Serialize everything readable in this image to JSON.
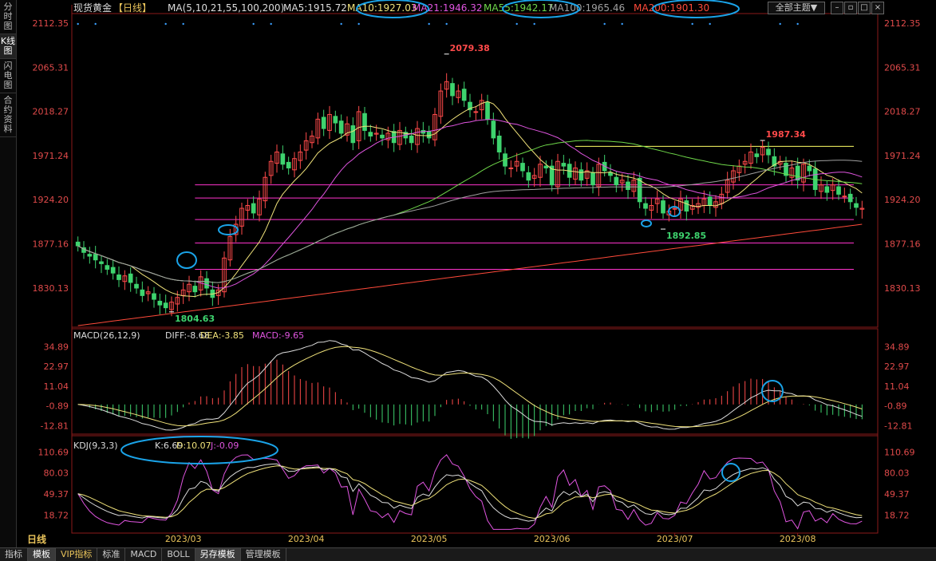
{
  "sidebar": {
    "tabs": [
      {
        "label": "分时图",
        "active": false
      },
      {
        "label": "K线图",
        "active": true
      },
      {
        "label": "闪电图",
        "active": false
      },
      {
        "label": "合约资料",
        "active": false
      }
    ]
  },
  "header": {
    "instrument": "现货黄金",
    "period_tag": "【日线】",
    "ma_label": "MA(5,10,21,55,100,200)",
    "ma_values": [
      {
        "label": "MA5:1915.72",
        "color": "#dcdcdc"
      },
      {
        "label": "MA10:1927.03",
        "color": "#f0e27a"
      },
      {
        "label": "MA21:1946.32",
        "color": "#e055e0"
      },
      {
        "label": "MA55:1942.17",
        "color": "#6fd84a"
      },
      {
        "label": "MA100:1965.46",
        "color": "#a0a0a0"
      },
      {
        "label": "MA200:1901.30",
        "color": "#ff4a3a"
      }
    ],
    "theme_button": "全部主题▼"
  },
  "bottom_tabs": [
    {
      "label": "指标",
      "vip": false,
      "active": false
    },
    {
      "label": "模板",
      "vip": false,
      "active": true
    },
    {
      "label": "VIP指标",
      "vip": true,
      "active": false
    },
    {
      "label": "标准",
      "vip": false,
      "active": false
    },
    {
      "label": "MACD",
      "vip": false,
      "active": false
    },
    {
      "label": "BOLL",
      "vip": false,
      "active": false
    },
    {
      "label": "另存模板",
      "vip": false,
      "active": true
    },
    {
      "label": "管理模板",
      "vip": false,
      "active": false
    }
  ],
  "period_label": "日线",
  "chart_data": [
    {
      "type": "candlestick",
      "x_ticks": [
        "2023/03",
        "2023/04",
        "2023/05",
        "2023/06",
        "2023/07",
        "2023/08"
      ],
      "y_ticks": [
        2112.35,
        2065.31,
        2018.27,
        1971.24,
        1924.2,
        1877.16,
        1830.13
      ],
      "ylim": [
        1790,
        2120
      ],
      "annotations": [
        {
          "text": "2079.38",
          "value": 2079.38
        },
        {
          "text": "1987.34",
          "value": 1987.34
        },
        {
          "text": "1892.85",
          "value": 1892.85
        },
        {
          "text": "1804.63",
          "value": 1804.63
        }
      ],
      "horizontal_levels": [
        {
          "value": 1981,
          "color": "#ffff66"
        },
        {
          "value": 1940,
          "color": "#ff33cc"
        },
        {
          "value": 1926,
          "color": "#ff33cc"
        },
        {
          "value": 1903,
          "color": "#ff33cc"
        },
        {
          "value": 1878,
          "color": "#ff33cc"
        },
        {
          "value": 1850,
          "color": "#ff33cc"
        }
      ],
      "closes": [
        1875,
        1868,
        1864,
        1860,
        1856,
        1850,
        1846,
        1839,
        1843,
        1836,
        1830,
        1822,
        1826,
        1818,
        1812,
        1809,
        1815,
        1820,
        1828,
        1834,
        1826,
        1842,
        1830,
        1820,
        1828,
        1862,
        1885,
        1898,
        1915,
        1918,
        1910,
        1925,
        1948,
        1965,
        1975,
        1962,
        1958,
        1968,
        1975,
        1987,
        1992,
        2010,
        2000,
        2015,
        2006,
        1995,
        2005,
        1985,
        2018,
        1998,
        1992,
        1995,
        1990,
        1995,
        1985,
        1998,
        1990,
        1985,
        2000,
        1995,
        1990,
        2015,
        2040,
        2050,
        2035,
        2040,
        2030,
        2020,
        2018,
        2030,
        2010,
        1990,
        1975,
        1960,
        1958,
        1965,
        1955,
        1945,
        1950,
        1962,
        1958,
        1940,
        1965,
        1960,
        1948,
        1958,
        1945,
        1955,
        1940,
        1962,
        1955,
        1950,
        1940,
        1945,
        1935,
        1945,
        1922,
        1915,
        1918,
        1925,
        1910,
        1912,
        1915,
        1925,
        1912,
        1918,
        1920,
        1925,
        1918,
        1922,
        1930,
        1945,
        1955,
        1960,
        1965,
        1975,
        1970,
        1980,
        1972,
        1960,
        1965,
        1950,
        1958,
        1945,
        1962,
        1955,
        1935,
        1940,
        1932,
        1940,
        1930,
        1928,
        1922,
        1916,
        1915
      ],
      "moving_averages": [
        {
          "name": "MA10",
          "color": "#f0e27a"
        },
        {
          "name": "MA21",
          "color": "#e055e0"
        },
        {
          "name": "MA55",
          "color": "#6fd84a"
        },
        {
          "name": "MA100",
          "color": "#a0a0a0"
        },
        {
          "name": "MA200",
          "color": "#ff4a3a",
          "values_start": 1790,
          "values_end": 1898
        }
      ]
    },
    {
      "type": "macd",
      "title": "MACD(26,12,9)",
      "legend": [
        {
          "label": "DIFF:-8.68",
          "color": "#dcdcdc"
        },
        {
          "label": "DEA:-3.85",
          "color": "#f0e27a"
        },
        {
          "label": "MACD:-9.65",
          "color": "#e055e0"
        }
      ],
      "y_ticks": [
        34.89,
        22.97,
        11.04,
        -0.89,
        -12.81
      ],
      "ylim": [
        -16,
        38
      ]
    },
    {
      "type": "kdj",
      "title": "KDJ(9,3,3)",
      "legend": [
        {
          "label": "K:6.69",
          "color": "#dcdcdc"
        },
        {
          "label": "D:10.07",
          "color": "#f0e27a"
        },
        {
          "label": "J:-0.09",
          "color": "#e055e0"
        }
      ],
      "y_ticks": [
        110.69,
        80.03,
        49.37,
        18.72
      ],
      "ylim": [
        -5,
        118
      ]
    }
  ]
}
